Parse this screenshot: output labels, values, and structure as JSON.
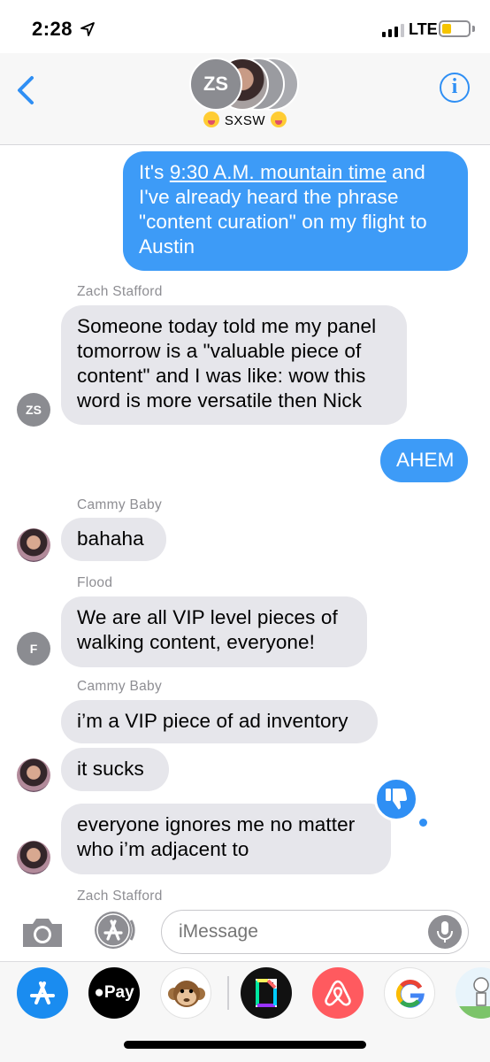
{
  "status_bar": {
    "time": "2:28",
    "network": "LTE",
    "battery_level": 0.35,
    "signal_bars": 3
  },
  "header": {
    "avatar_initials": "ZS",
    "group_name": "SXSW",
    "info_label": "i"
  },
  "messages": [
    {
      "type": "sent",
      "parts": [
        "It's ",
        "9:30 A.M. mountain time",
        " and I've already heard the phrase \"content curation\" on my flight to Austin"
      ]
    },
    {
      "type": "sender",
      "text": "Zach Stafford"
    },
    {
      "type": "received",
      "text": "Someone today told me my panel tomorrow is a \"valuable piece of content\" and I was like: wow this word is more versatile then Nick",
      "avatar_initials": "ZS"
    },
    {
      "type": "sent",
      "text": "AHEM"
    },
    {
      "type": "sender",
      "text": "Cammy Baby"
    },
    {
      "type": "received",
      "text": "bahaha"
    },
    {
      "type": "sender",
      "text": "Flood"
    },
    {
      "type": "received",
      "text": "We are all VIP level pieces of walking content, everyone!",
      "avatar_initials": "F"
    },
    {
      "type": "sender",
      "text": "Cammy Baby"
    },
    {
      "type": "received",
      "text": "i’m a VIP piece of ad inventory"
    },
    {
      "type": "received",
      "text": "it sucks"
    },
    {
      "type": "received",
      "text": "everyone ignores me no matter who i’m adjacent to",
      "tapback": "thumbs-down"
    },
    {
      "type": "sender",
      "text": "Zach Stafford"
    }
  ],
  "input": {
    "placeholder": "iMessage"
  },
  "app_tray": {
    "apple_pay_label": "Pay",
    "apps": [
      "app-store",
      "apple-pay",
      "animoji",
      "giphy",
      "airbnb",
      "google",
      "sticker"
    ]
  },
  "colors": {
    "sent_bubble": "#3d9bf7",
    "received_bubble": "#e6e6eb",
    "accent": "#2f8ff4"
  }
}
